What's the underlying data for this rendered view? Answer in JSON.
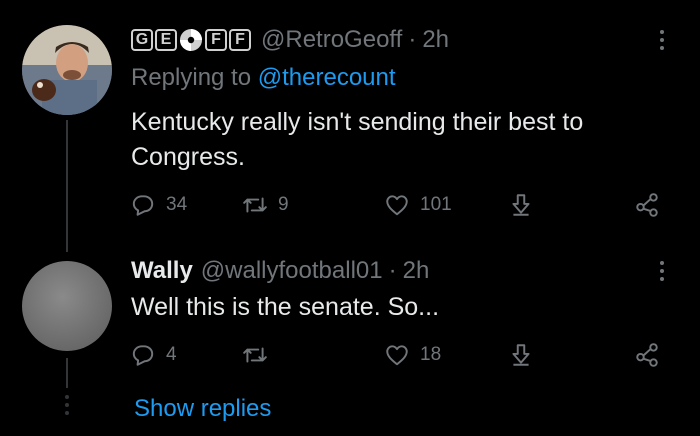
{
  "tweet1": {
    "display_name_badges": [
      "G",
      "E",
      "",
      "F",
      "F"
    ],
    "handle": "@RetroGeoff",
    "separator": "·",
    "time": "2h",
    "replying_prefix": "Replying to",
    "replying_to": "@therecount",
    "text": "Kentucky really isn't sending their best to Congress.",
    "actions": {
      "replies": "34",
      "retweets": "9",
      "likes": "101"
    }
  },
  "tweet2": {
    "name": "Wally",
    "handle": "@wallyfootball01",
    "separator": "·",
    "time": "2h",
    "text": "Well this is the senate. So...",
    "actions": {
      "replies": "4",
      "likes": "18"
    }
  },
  "show_replies": "Show replies",
  "colors": {
    "background": "#000000",
    "text": "#e7e9ea",
    "muted": "#71767b",
    "accent": "#1d9bf0"
  },
  "icons": [
    "more-icon",
    "reply-icon",
    "retweet-icon",
    "like-icon",
    "bookmark-icon",
    "share-icon",
    "disc-icon"
  ]
}
